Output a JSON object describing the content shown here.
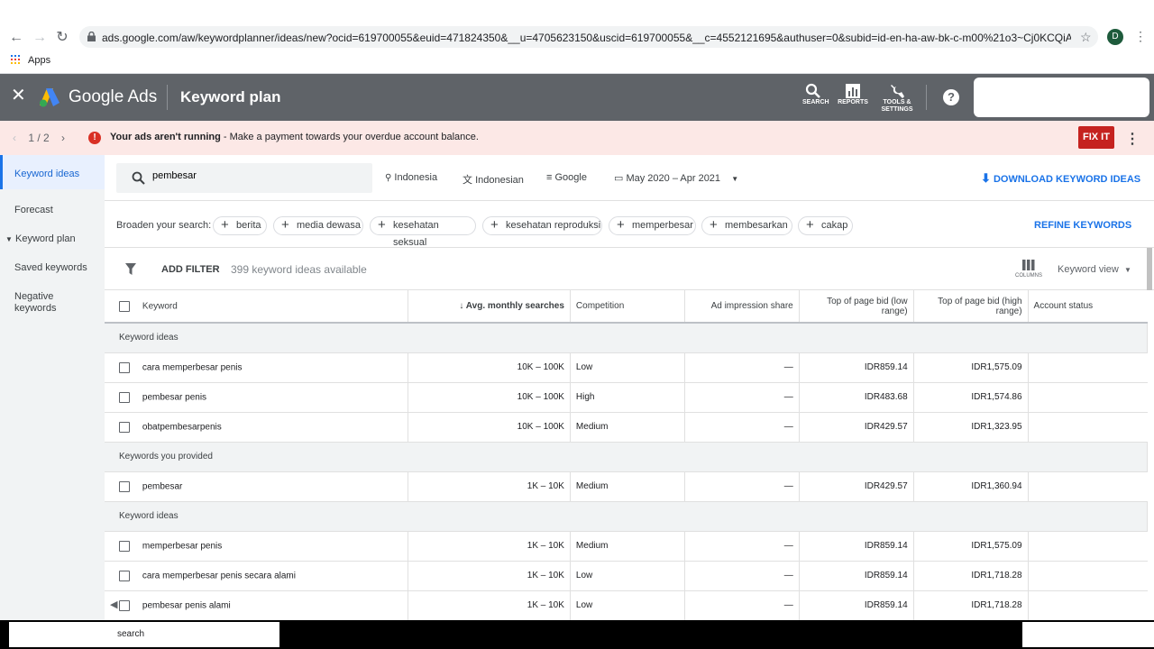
{
  "browser": {
    "url": "ads.google.com/aw/keywordplanner/ideas/new?ocid=619700055&euid=471824350&__u=4705623150&uscid=619700055&__c=4552121695&authuser=0&subid=id-en-ha-aw-bk-c-m00%21o3~Cj0KCQiA4L2BBhCvA...",
    "profile_initial": "D",
    "bookmarks_apps": "Apps"
  },
  "header": {
    "brand": "Google Ads",
    "title": "Keyword plan",
    "tools": [
      {
        "label": "SEARCH",
        "icon": "search-icon"
      },
      {
        "label": "REPORTS",
        "icon": "reports-icon"
      },
      {
        "label": "TOOLS & SETTINGS",
        "icon": "wrench-icon"
      }
    ],
    "help": "?"
  },
  "alert": {
    "pager": "1 / 2",
    "bold": "Your ads aren't running",
    "rest": " - Make a payment towards your overdue account balance.",
    "fix": "FIX IT"
  },
  "sidebar": {
    "items": [
      "Keyword ideas",
      "Forecast",
      "Keyword plan",
      "Saved keywords",
      "Negative keywords"
    ]
  },
  "search": {
    "value": "pembesar",
    "location": "Indonesia",
    "language": "Indonesian",
    "network": "Google",
    "date_range": "May 2020 – Apr 2021",
    "download": "DOWNLOAD KEYWORD IDEAS"
  },
  "broaden": {
    "label": "Broaden your search:",
    "chips": [
      "berita",
      "media dewasa",
      "kesehatan seksual",
      "kesehatan reproduksi",
      "memperbesar",
      "membesarkan",
      "cakap"
    ],
    "refine": "REFINE KEYWORDS"
  },
  "filter": {
    "add": "ADD FILTER",
    "count": "399 keyword ideas available",
    "columns": "COLUMNS",
    "view": "Keyword view"
  },
  "table": {
    "headers": [
      "Keyword",
      "Avg. monthly searches",
      "Competition",
      "Ad impression share",
      "Top of page bid (low range)",
      "Top of page bid (high range)",
      "Account status"
    ],
    "groups": [
      {
        "title": "Keyword ideas",
        "rows": [
          [
            "cara memperbesar penis",
            "10K – 100K",
            "Low",
            "—",
            "IDR859.14",
            "IDR1,575.09"
          ],
          [
            "pembesar penis",
            "10K – 100K",
            "High",
            "—",
            "IDR483.68",
            "IDR1,574.86"
          ],
          [
            "obatpembesarpenis",
            "10K – 100K",
            "Medium",
            "—",
            "IDR429.57",
            "IDR1,323.95"
          ]
        ]
      },
      {
        "title": "Keywords you provided",
        "rows": [
          [
            "pembesar",
            "1K – 10K",
            "Medium",
            "—",
            "IDR429.57",
            "IDR1,360.94"
          ]
        ]
      },
      {
        "title": "Keyword ideas",
        "rows": [
          [
            "memperbesar penis",
            "1K – 10K",
            "Medium",
            "—",
            "IDR859.14",
            "IDR1,575.09"
          ],
          [
            "cara memperbesar penis secara alami",
            "1K – 10K",
            "Low",
            "—",
            "IDR859.14",
            "IDR1,718.28"
          ],
          [
            "pembesar penis alami",
            "1K – 10K",
            "Low",
            "—",
            "IDR859.14",
            "IDR1,718.28"
          ]
        ]
      }
    ]
  },
  "taskbar": {
    "search_text": "search"
  }
}
